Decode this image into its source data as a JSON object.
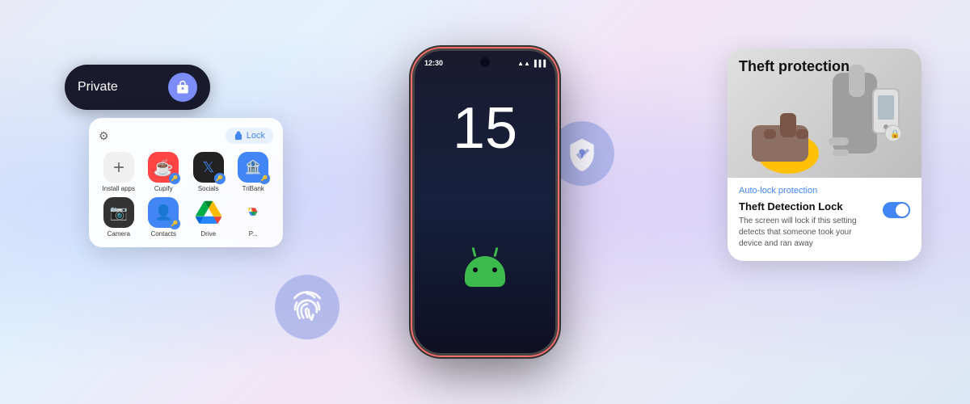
{
  "background": {
    "colors": [
      "#e8eaf6",
      "#e3f2fd",
      "#f3e5f5"
    ]
  },
  "phone": {
    "status_time": "12:30",
    "number": "15"
  },
  "left_panel": {
    "private_label": "Private",
    "lock_button_label": "Lock",
    "apps": [
      {
        "label": "Install apps",
        "type": "install"
      },
      {
        "label": "Cupify",
        "type": "cupify"
      },
      {
        "label": "Socials",
        "type": "socials"
      },
      {
        "label": "TriBank",
        "type": "tribank"
      },
      {
        "label": "Camera",
        "type": "camera"
      },
      {
        "label": "Contacts",
        "type": "contacts"
      },
      {
        "label": "Drive",
        "type": "drive"
      },
      {
        "label": "Photos",
        "type": "photos"
      }
    ]
  },
  "right_panel": {
    "card_title": "Theft protection",
    "auto_lock_label": "Auto-lock protection",
    "feature_title": "Theft Detection Lock",
    "feature_desc": "The screen will lock if this setting detects that someone took your device and ran away",
    "toggle_enabled": true
  },
  "bubbles": {
    "fingerprint_aria": "fingerprint",
    "shield_aria": "security shield"
  }
}
